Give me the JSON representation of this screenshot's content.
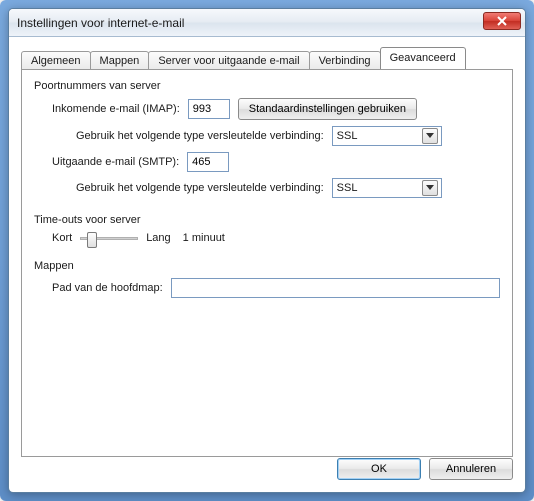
{
  "window": {
    "title": "Instellingen voor internet-e-mail"
  },
  "tabs": {
    "items": [
      {
        "label": "Algemeen"
      },
      {
        "label": "Mappen"
      },
      {
        "label": "Server voor uitgaande e-mail"
      },
      {
        "label": "Verbinding"
      },
      {
        "label": "Geavanceerd"
      }
    ]
  },
  "groups": {
    "ports": {
      "legend": "Poortnummers van server",
      "imap_label": "Inkomende e-mail (IMAP):",
      "imap_value": "993",
      "defaults_btn": "Standaardinstellingen gebruiken",
      "enc_label": "Gebruik het volgende type versleutelde verbinding:",
      "imap_enc": "SSL",
      "smtp_label": "Uitgaande e-mail (SMTP):",
      "smtp_value": "465",
      "smtp_enc": "SSL"
    },
    "timeouts": {
      "legend": "Time-outs voor server",
      "short": "Kort",
      "long": "Lang",
      "value": "1 minuut"
    },
    "folders": {
      "legend": "Mappen",
      "root_label": "Pad van de hoofdmap:",
      "root_value": ""
    }
  },
  "buttons": {
    "ok": "OK",
    "cancel": "Annuleren"
  }
}
